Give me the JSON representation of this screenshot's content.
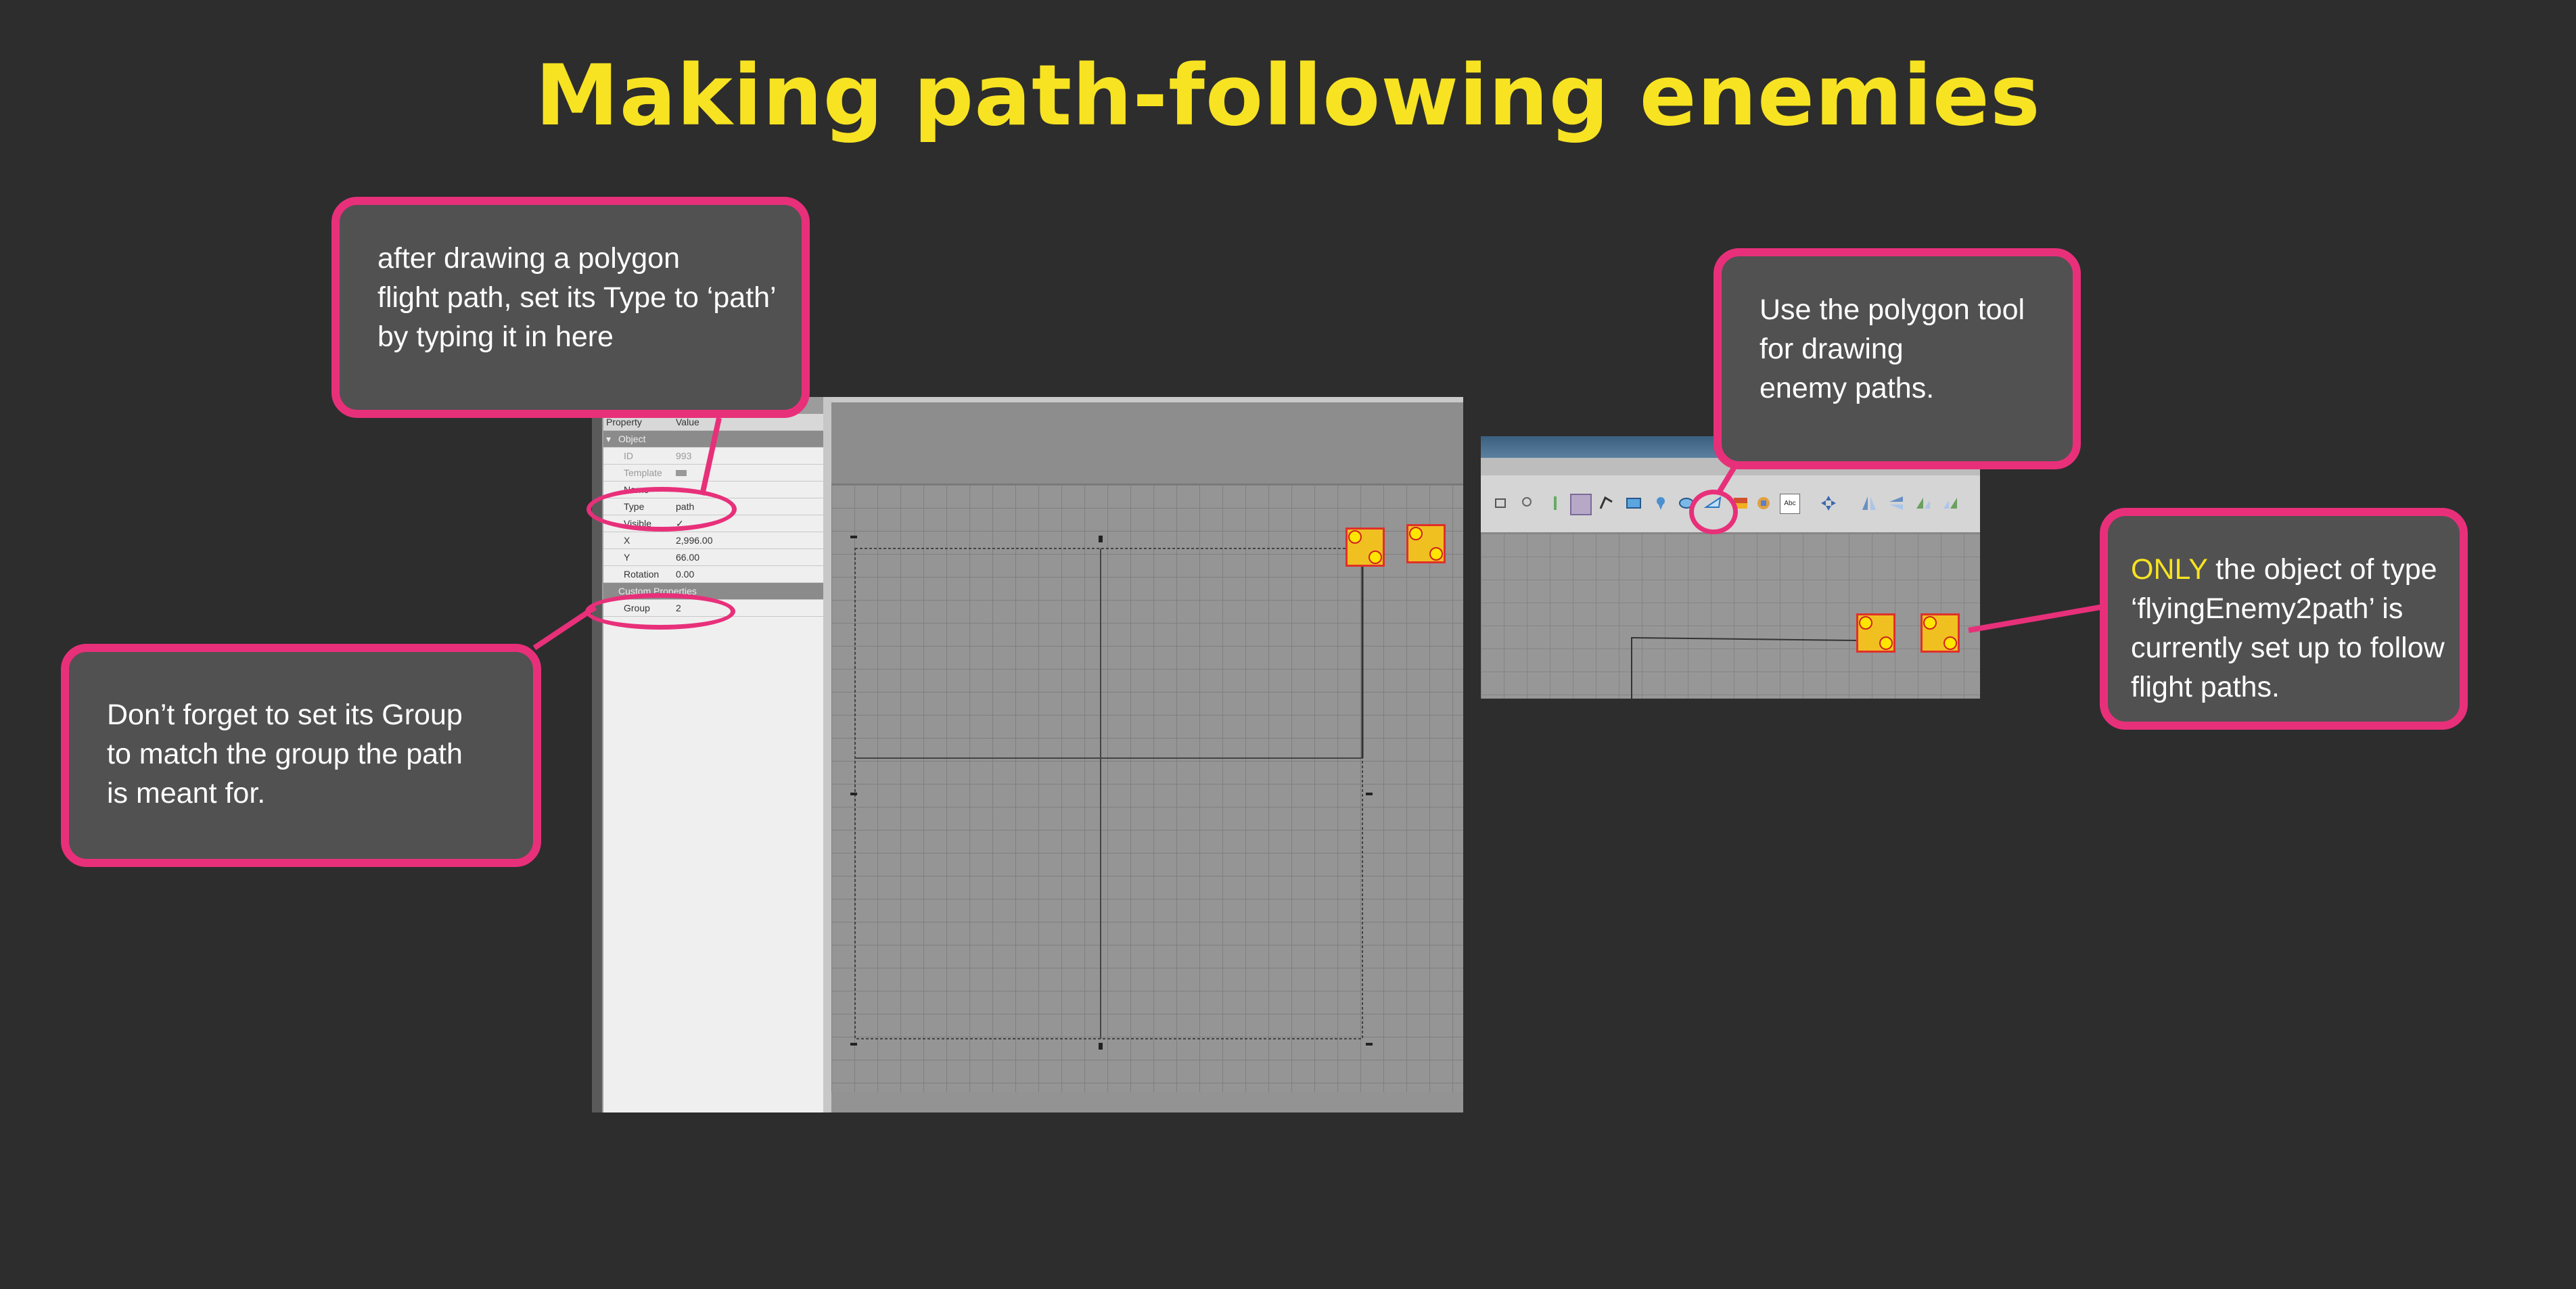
{
  "title": "Making  path-following enemies",
  "callouts": {
    "type_hint": [
      "after drawing a polygon",
      "flight path, set its Type to ‘path’",
      "by typing it in here"
    ],
    "group_hint": [
      "Don’t forget to set its Group",
      "to match the group the path",
      "is meant for."
    ],
    "polygon_hint": [
      "Use the polygon tool",
      "for drawing",
      "enemy paths."
    ],
    "only_hint": {
      "highlight": "ONLY",
      "first_rest": " the object of type",
      "lines": [
        "‘flyingEnemy2path’ is",
        "currently set up to follow",
        "flight paths."
      ]
    }
  },
  "properties": {
    "header": {
      "key": "Property",
      "value": "Value"
    },
    "sections": {
      "object": "Object",
      "custom": "Custom Properties"
    },
    "rows": [
      {
        "key": "ID",
        "value": "993"
      },
      {
        "key": "Template",
        "value": ""
      },
      {
        "key": "Name",
        "value": ""
      },
      {
        "key": "Type",
        "value": "path"
      },
      {
        "key": "Visible",
        "value": "✓"
      },
      {
        "key": "X",
        "value": "2,996.00"
      },
      {
        "key": "Y",
        "value": "66.00"
      },
      {
        "key": "Rotation",
        "value": "0.00"
      }
    ],
    "custom_rows": [
      {
        "key": "Group",
        "value": "2"
      }
    ]
  },
  "toolbar": {
    "icons": [
      "select-icon",
      "zoom-icon",
      "stamp-icon",
      "object-select-icon",
      "edit-polygon-icon",
      "rectangle-icon",
      "point-icon",
      "ellipse-icon",
      "polygon-icon",
      "tile-object-icon",
      "template-icon",
      "text-icon",
      "move-icon",
      "flip-horizontal-icon",
      "flip-vertical-icon",
      "rotate-left-icon",
      "rotate-right-icon"
    ],
    "text_tool_label": "Abc"
  },
  "colors": {
    "accent": "#e8307a",
    "title": "#f7e322",
    "background": "#2d2d2d",
    "callout_fill": "#515151"
  }
}
